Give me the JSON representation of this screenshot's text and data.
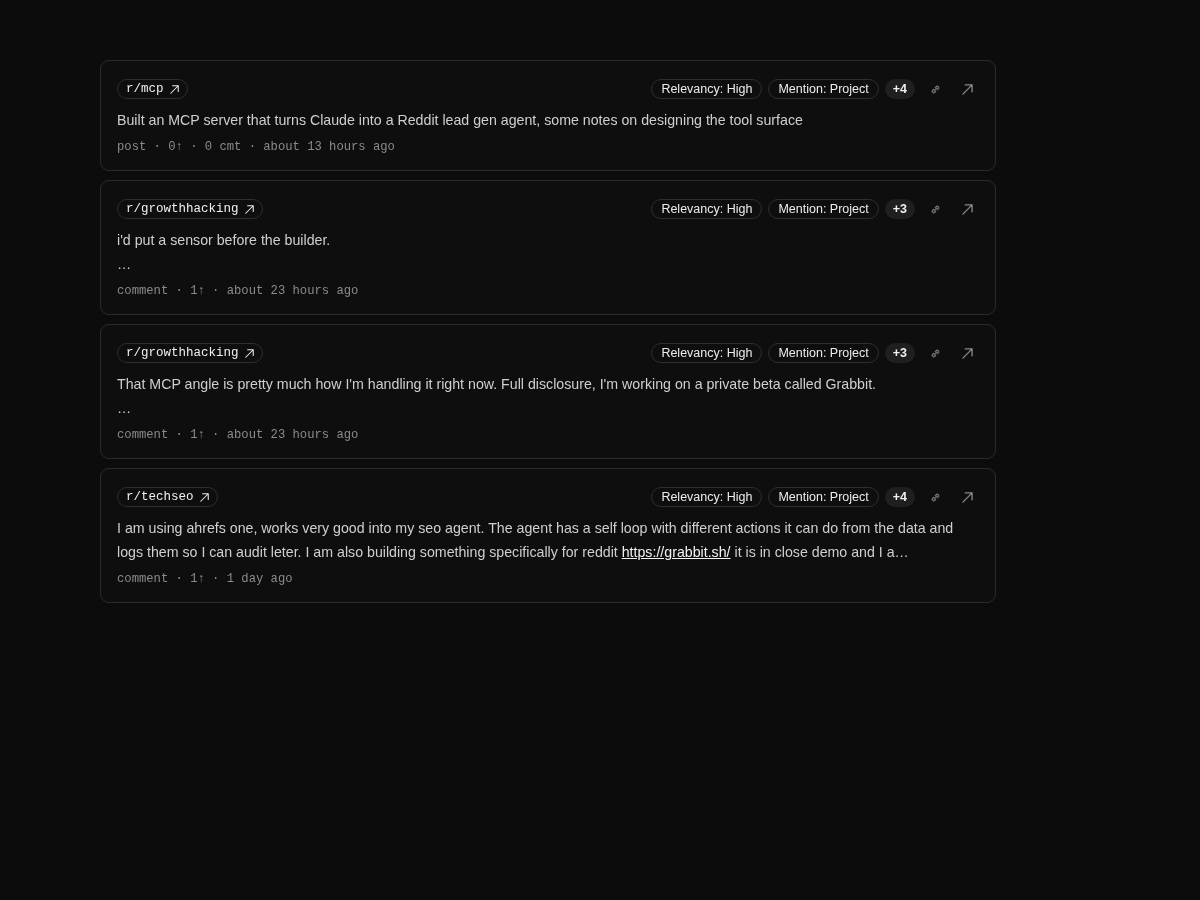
{
  "mentions": [
    {
      "subreddit": "r/mcp",
      "tags": [
        {
          "label": "Relevancy: High"
        },
        {
          "label": "Mention: Project"
        }
      ],
      "more": "+4",
      "body": [
        [
          {
            "kind": "text",
            "text": "Built an MCP server that turns Claude into a Reddit lead gen agent, some notes on designing the tool surface"
          }
        ]
      ],
      "meta": "post · 0↑ · 0 cmt · about 13 hours ago"
    },
    {
      "subreddit": "r/growthhacking",
      "tags": [
        {
          "label": "Relevancy: High"
        },
        {
          "label": "Mention: Project"
        }
      ],
      "more": "+3",
      "body": [
        [
          {
            "kind": "text",
            "text": "i'd put a sensor before the builder."
          }
        ],
        [
          {
            "kind": "text",
            "text": "…"
          }
        ]
      ],
      "meta": "comment · 1↑ · about 23 hours ago"
    },
    {
      "subreddit": "r/growthhacking",
      "tags": [
        {
          "label": "Relevancy: High"
        },
        {
          "label": "Mention: Project"
        }
      ],
      "more": "+3",
      "body": [
        [
          {
            "kind": "text",
            "text": "That MCP angle is pretty much how I'm handling it right now. Full disclosure, I'm working on a private beta called Grabbit."
          }
        ],
        [
          {
            "kind": "text",
            "text": "…"
          }
        ]
      ],
      "meta": "comment · 1↑ · about 23 hours ago"
    },
    {
      "subreddit": "r/techseo",
      "tags": [
        {
          "label": "Relevancy: High"
        },
        {
          "label": "Mention: Project"
        }
      ],
      "more": "+4",
      "body": [
        [
          {
            "kind": "text",
            "text": "I am using ahrefs one, works very good into my seo agent. The agent has a self loop with different actions it can do from the data and logs them so I can audit leter. I am also building something specifically for reddit "
          },
          {
            "kind": "link",
            "text": "https://grabbit.sh/"
          },
          {
            "kind": "text",
            "text": " it is in close demo and I a…"
          }
        ]
      ],
      "meta": "comment · 1↑ · 1 day ago"
    }
  ]
}
